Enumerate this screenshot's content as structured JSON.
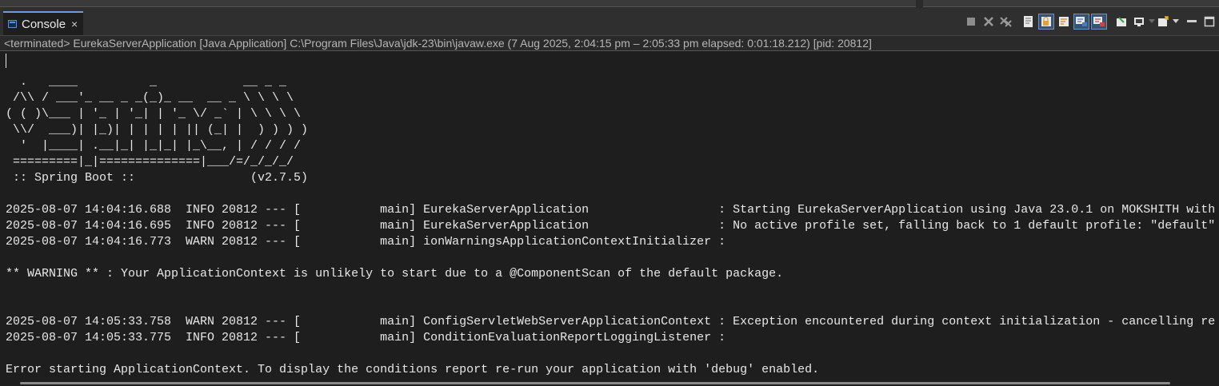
{
  "tab": {
    "label": "Console",
    "close_glyph": "×",
    "icon": "console-icon"
  },
  "toolbar": {
    "icons": [
      "terminate-icon",
      "remove-launch-icon",
      "remove-all-terminated-icon",
      "clear-console-icon",
      "scroll-lock-icon",
      "word-wrap-icon",
      "show-console-on-stdout-icon",
      "show-console-on-stderr-icon",
      "pin-console-icon",
      "display-selected-console-icon",
      "open-console-icon",
      "minimize-icon",
      "maximize-icon"
    ]
  },
  "process_line": "<terminated> EurekaServerApplication [Java Application] C:\\Program Files\\Java\\jdk-23\\bin\\javaw.exe  (7 Aug 2025, 2:04:15 pm – 2:05:33 pm elapsed: 0:01:18.212) [pid: 20812]",
  "console_output": "\n  .   ____          _            __ _ _\n /\\\\ / ___'_ __ _ _(_)_ __  __ _ \\ \\ \\ \\\n( ( )\\___ | '_ | '_| | '_ \\/ _` | \\ \\ \\ \\\n \\\\/  ___)| |_)| | | | | || (_| |  ) ) ) )\n  '  |____| .__|_| |_|_| |_\\__, | / / / /\n =========|_|==============|___/=/_/_/_/\n :: Spring Boot ::                (v2.7.5)\n\n2025-08-07 14:04:16.688  INFO 20812 --- [           main] EurekaServerApplication                  : Starting EurekaServerApplication using Java 23.0.1 on MOKSHITH with\n2025-08-07 14:04:16.695  INFO 20812 --- [           main] EurekaServerApplication                  : No active profile set, falling back to 1 default profile: \"default\"\n2025-08-07 14:04:16.773  WARN 20812 --- [           main] ionWarningsApplicationContextInitializer :\n\n** WARNING ** : Your ApplicationContext is unlikely to start due to a @ComponentScan of the default package.\n\n\n2025-08-07 14:05:33.758  WARN 20812 --- [           main] ConfigServletWebServerApplicationContext : Exception encountered during context initialization - cancelling re\n2025-08-07 14:05:33.775  INFO 20812 --- [           main] ConditionEvaluationReportLoggingListener :\n\nError starting ApplicationContext. To display the conditions report re-run your application with 'debug' enabled."
}
